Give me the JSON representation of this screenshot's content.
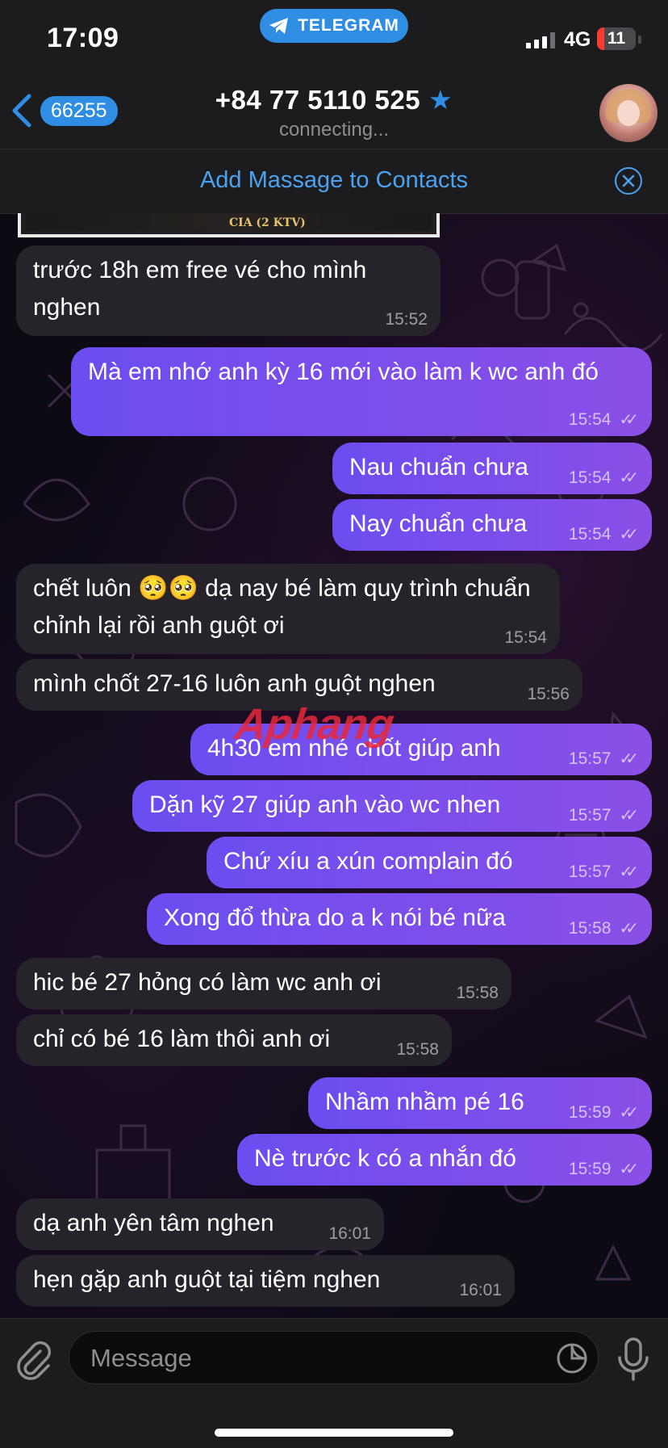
{
  "status_bar": {
    "time": "17:09",
    "app_pill": "TELEGRAM",
    "network": "4G",
    "battery": "11",
    "accent_color": "#2f8de4"
  },
  "header": {
    "back_count": "66255",
    "title": "+84 77 5110 525",
    "subtitle": "connecting...",
    "verified_icon": "star-icon"
  },
  "contact_bar": {
    "label": "Add Massage to Contacts"
  },
  "image_caption": "CIA (2 KTV)",
  "watermark": {
    "part1": "Aphang",
    "part2": ""
  },
  "messages": [
    {
      "dir": "in",
      "text": "trước 18h em free vé cho mình nghen",
      "time": "15:52"
    },
    {
      "dir": "out",
      "text": "Mà em nhớ anh kỳ 16 mới vào làm k wc anh đó",
      "time": "15:54"
    },
    {
      "dir": "out",
      "text": "Nau chuẩn chưa",
      "time": "15:54"
    },
    {
      "dir": "out",
      "text": "Nay chuẩn chưa",
      "time": "15:54"
    },
    {
      "dir": "in",
      "text": "chết luôn 🥺🥺 dạ nay bé làm quy trình chuẩn chỉnh lại rồi anh guột ơi",
      "time": "15:54"
    },
    {
      "dir": "in",
      "text": "mình chốt 27-16 luôn anh guột nghen",
      "time": "15:56"
    },
    {
      "dir": "out",
      "text": "4h30 em nhé chốt giúp anh",
      "time": "15:57"
    },
    {
      "dir": "out",
      "text": "Dặn kỹ 27 giúp anh vào wc nhen",
      "time": "15:57"
    },
    {
      "dir": "out",
      "text": "Chứ xíu a xún complain đó",
      "time": "15:57"
    },
    {
      "dir": "out",
      "text": "Xong đổ thừa do a k nói bé nữa",
      "time": "15:58"
    },
    {
      "dir": "in",
      "text": "hic bé 27 hỏng có làm wc anh ơi",
      "time": "15:58"
    },
    {
      "dir": "in",
      "text": "chỉ có bé 16 làm thôi anh ơi",
      "time": "15:58"
    },
    {
      "dir": "out",
      "text": "Nhầm nhầm pé 16",
      "time": "15:59"
    },
    {
      "dir": "out",
      "text": "Nè trước k có a nhắn đó",
      "time": "15:59"
    },
    {
      "dir": "in",
      "text": "dạ anh yên tâm nghen",
      "time": "16:01"
    },
    {
      "dir": "in",
      "text": "hẹn gặp anh guột tại tiệm nghen",
      "time": "16:01"
    }
  ],
  "read_ticks": "✓✓",
  "composer": {
    "placeholder": "Message",
    "attach_icon": "paperclip-icon",
    "sticker_icon": "sticker-icon",
    "mic_icon": "microphone-icon"
  }
}
